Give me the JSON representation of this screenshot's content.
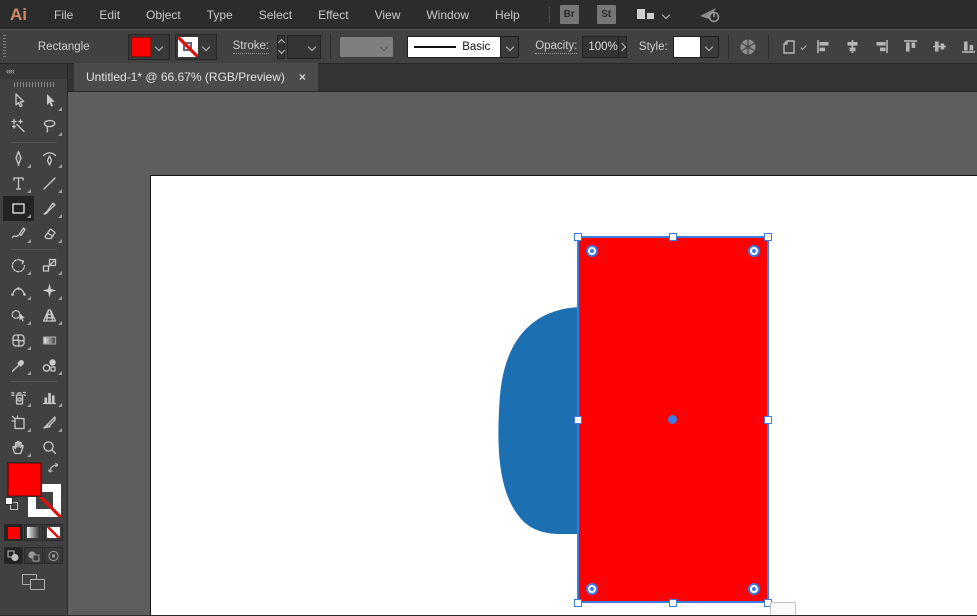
{
  "window": {
    "logo_text": "Ai"
  },
  "menubar": {
    "items": [
      "File",
      "Edit",
      "Object",
      "Type",
      "Select",
      "Effect",
      "View",
      "Window",
      "Help"
    ],
    "bridge_label": "Br",
    "stock_label": "St",
    "icons": [
      "workspace-switcher-icon",
      "share-icon"
    ]
  },
  "control_bar": {
    "context_label": "Rectangle",
    "fill_color": "#FF0000",
    "stroke_swatch": "none",
    "stroke_label": "Stroke:",
    "stroke_weight_value": "",
    "brush_definition": "Basic",
    "opacity_label": "Opacity:",
    "opacity_value": "100%",
    "style_label": "Style:",
    "icons": [
      "recolor-artwork-icon",
      "document-setup-icon",
      "align-left-icon",
      "align-center-horizontal-icon",
      "align-right-icon",
      "align-top-icon",
      "align-center-vertical-icon",
      "align-bottom-icon"
    ]
  },
  "tab": {
    "title": "Untitled-1* @ 66.67% (RGB/Preview)",
    "close_glyph": "×"
  },
  "toolbar": {
    "tools": [
      "selection",
      "direct-selection",
      "magic-wand",
      "lasso",
      "pen",
      "curvature",
      "type",
      "line-segment",
      "rectangle",
      "paintbrush",
      "shaper",
      "eraser",
      "rotate",
      "scale",
      "width",
      "puppet-warp",
      "shape-builder",
      "perspective-grid",
      "mesh",
      "gradient",
      "eyedropper",
      "blend",
      "symbol-sprayer",
      "column-graph",
      "artboard",
      "slice",
      "hand",
      "zoom"
    ],
    "active_tool": "rectangle",
    "fill_color": "#FF0000",
    "stroke_color": "none"
  },
  "canvas": {
    "zoom_percent": "66.67%",
    "pasteboard_color": "#5E5E5E",
    "artboard_color": "#FFFFFF",
    "selection_color": "#3C7BE4",
    "shapes": [
      {
        "type": "blob",
        "fill": "#1C6FB0",
        "selected": false
      },
      {
        "type": "rectangle",
        "fill": "#FF0000",
        "selected": true
      }
    ]
  }
}
